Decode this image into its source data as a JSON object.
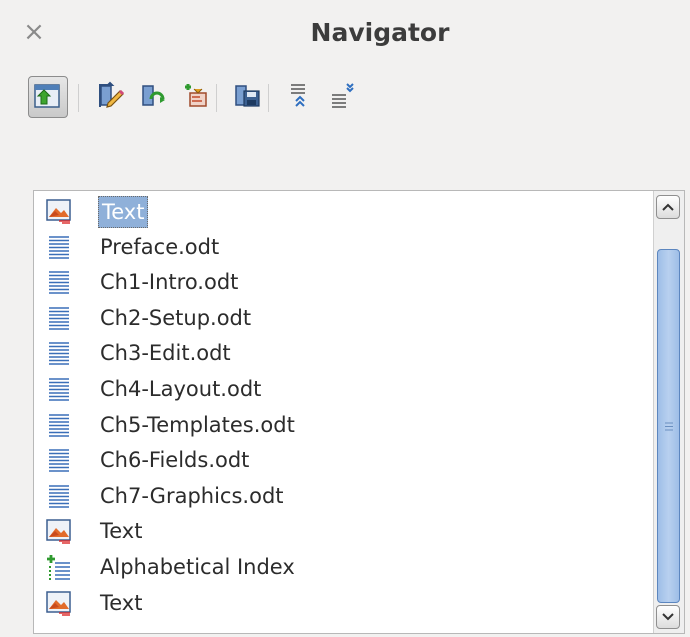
{
  "window": {
    "title": "Navigator"
  },
  "toolbar": {
    "buttons": [
      {
        "icon": "toggle-content-navigation-icon",
        "active": true
      },
      {
        "icon": "edit-icon"
      },
      {
        "icon": "update-icon"
      },
      {
        "icon": "insert-icon"
      },
      {
        "icon": "save-contents-icon"
      },
      {
        "icon": "promote-chapter-icon"
      },
      {
        "icon": "demote-chapter-icon"
      }
    ]
  },
  "tree": {
    "items": [
      {
        "label": "Text",
        "icon": "text-section-icon",
        "selected": true
      },
      {
        "label": "Preface.odt",
        "icon": "document-link-icon"
      },
      {
        "label": "Ch1-Intro.odt",
        "icon": "document-link-icon"
      },
      {
        "label": "Ch2-Setup.odt",
        "icon": "document-link-icon"
      },
      {
        "label": "Ch3-Edit.odt",
        "icon": "document-link-icon"
      },
      {
        "label": "Ch4-Layout.odt",
        "icon": "document-link-icon"
      },
      {
        "label": "Ch5-Templates.odt",
        "icon": "document-link-icon"
      },
      {
        "label": "Ch6-Fields.odt",
        "icon": "document-link-icon"
      },
      {
        "label": "Ch7-Graphics.odt",
        "icon": "document-link-icon"
      },
      {
        "label": "Text",
        "icon": "text-section-icon"
      },
      {
        "label": "Alphabetical Index",
        "icon": "index-icon"
      },
      {
        "label": "Text",
        "icon": "text-section-icon"
      }
    ]
  },
  "colors": {
    "selection": "#8fb0d9",
    "scroll_thumb": "#9ebee7"
  }
}
